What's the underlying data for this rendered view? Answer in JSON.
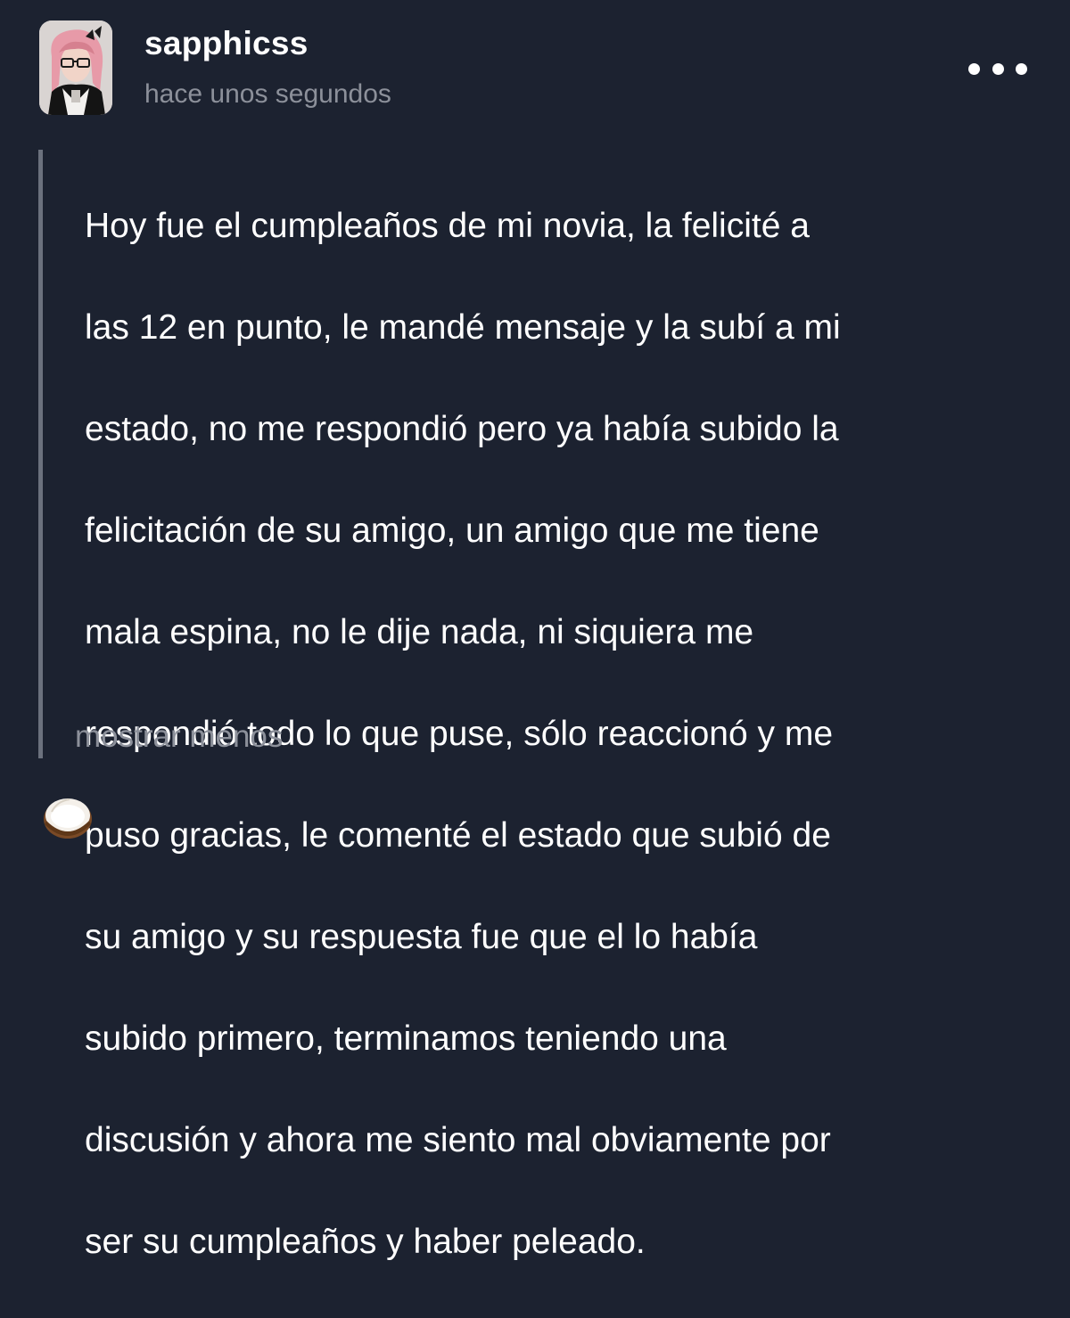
{
  "post": {
    "author": {
      "username": "sapphicss",
      "avatar_icon": "profile-photo"
    },
    "timestamp": "hace unos segundos",
    "menu_icon": "more-options-icon",
    "body_lines": [
      "Hoy fue el cumpleaños de mi novia, la felicité a",
      "las 12 en punto, le mandé mensaje y la subí a mi",
      "estado, no me respondió pero ya había subido la",
      "felicitación de su amigo, un amigo que me tiene",
      "mala espina, no le dije nada, ni siquiera me",
      "respondió todo lo que puse, sólo reaccionó y me",
      "puso gracias, le comenté el estado que subió de",
      "su amigo y su respuesta fue que el lo había",
      "subido primero, terminamos teniendo una",
      "discusión y ahora me siento mal obviamente por",
      "ser su cumpleaños y haber peleado."
    ],
    "show_less_label": "mostrar menos",
    "reaction_icon": "coconut-emoji"
  },
  "colors": {
    "background": "#1c2230",
    "text": "#ffffff",
    "muted": "#8c909a",
    "quote_bar": "#6b717d"
  }
}
